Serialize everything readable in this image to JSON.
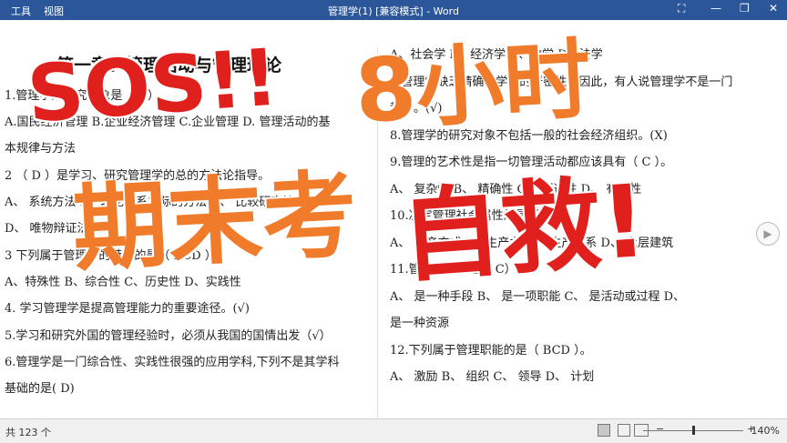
{
  "window": {
    "title": "管理学(1) [兼容模式] - Word",
    "menu": [
      "工具",
      "视图"
    ]
  },
  "left_col": [
    "第一章：管理活动与管理理论",
    "1.管理学的研究对象是（    D）",
    "A.国民经济管理  B.企业经济管理  C.企业管理  D. 管理活动的基",
    "本规律与方法",
    "2  （   D  ）是学习、研究管理学的总的方法论指导。",
    "A、 系统方法  B、理论联系实际的方法  C、 比较研究法",
    "D、  唯物辩证法",
    "3  下列属于管理学的特征的是（    BCD  ）",
    " A、特殊性   B、综合性  C、历史性   D、实践性",
    "4. 学习管理学是提高管理能力的重要途径。(√)",
    "5.学习和研究外国的管理经验时，必须从我国的国情出发（√）",
    "6.管理学是一门综合性、实践性很强的应用学科,下列不是其学科",
    "基础的是( D)"
  ],
  "right_col": [
    "A、社会学  B、经济学  C、数学  D、法学",
    "7.管理学缺乏精确科学中的严密性，因此，有人说管理学不是一门",
    "科学。(√)",
    "8.管理学的研究对象不包括一般的社会经济组织。(X)",
    "9.管理的艺术性是指一切管理活动都应该具有（    C  ）。",
    "A、  复杂性    B、  精确性   C、 创造性    D、 有效性",
    "10.决定管理社会属性的是（   C  ）",
    " A、  生产方式      B、生产力     C、  生产关系     D、  上层建筑",
    "11.管理的本质是（     C）",
    "  A、  是一种手段    B、  是一项职能  C、  是活动或过程    D、",
    "是一种资源",
    "12.下列属于管理职能的是（     BCD  ）。",
    " A、  激励     B、  组织   C、  领导   D、  计划"
  ],
  "overlay": {
    "sos": "SOS!!",
    "time": "8小时",
    "exam": "期末考",
    "save": "自救!"
  },
  "status": {
    "pages": "共 123 个",
    "zoom": "140%"
  }
}
